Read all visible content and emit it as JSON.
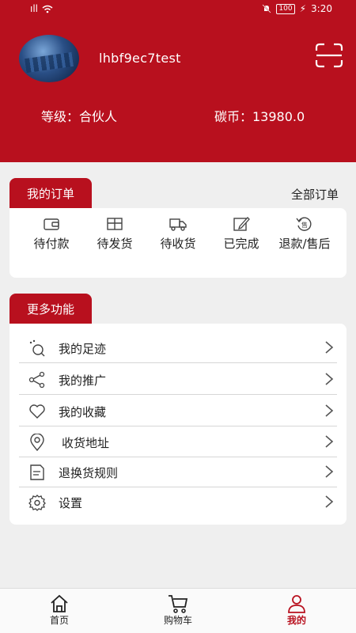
{
  "status_bar": {
    "signal": "ıll",
    "time": "3:20",
    "battery": "100"
  },
  "profile": {
    "username": "lhbf9ec7test",
    "level": "等级：合伙人",
    "coins": "碳币：13980.0"
  },
  "orders": {
    "title": "我的订单",
    "all_link": "全部订单",
    "items": [
      {
        "label": "待付款",
        "icon": "wallet-icon"
      },
      {
        "label": "待发货",
        "icon": "package-icon"
      },
      {
        "label": "待收货",
        "icon": "truck-icon"
      },
      {
        "label": "已完成",
        "icon": "edit-icon"
      },
      {
        "label": "退款/售后",
        "icon": "refund-icon"
      }
    ]
  },
  "more": {
    "title": "更多功能",
    "items": [
      {
        "label": "我的足迹",
        "icon": "footprint-icon"
      },
      {
        "label": "我的推广",
        "icon": "share-icon"
      },
      {
        "label": "我的收藏",
        "icon": "heart-icon"
      },
      {
        "label": "收货地址",
        "icon": "location-icon"
      },
      {
        "label": "退换货规则",
        "icon": "document-icon"
      },
      {
        "label": "设置",
        "icon": "gear-icon"
      }
    ]
  },
  "nav": {
    "items": [
      {
        "label": "首页",
        "icon": "home-icon"
      },
      {
        "label": "购物车",
        "icon": "cart-icon"
      },
      {
        "label": "我的",
        "icon": "user-icon"
      }
    ],
    "active_index": 2
  },
  "colors": {
    "brand": "#b8101e",
    "background": "#efefef"
  }
}
